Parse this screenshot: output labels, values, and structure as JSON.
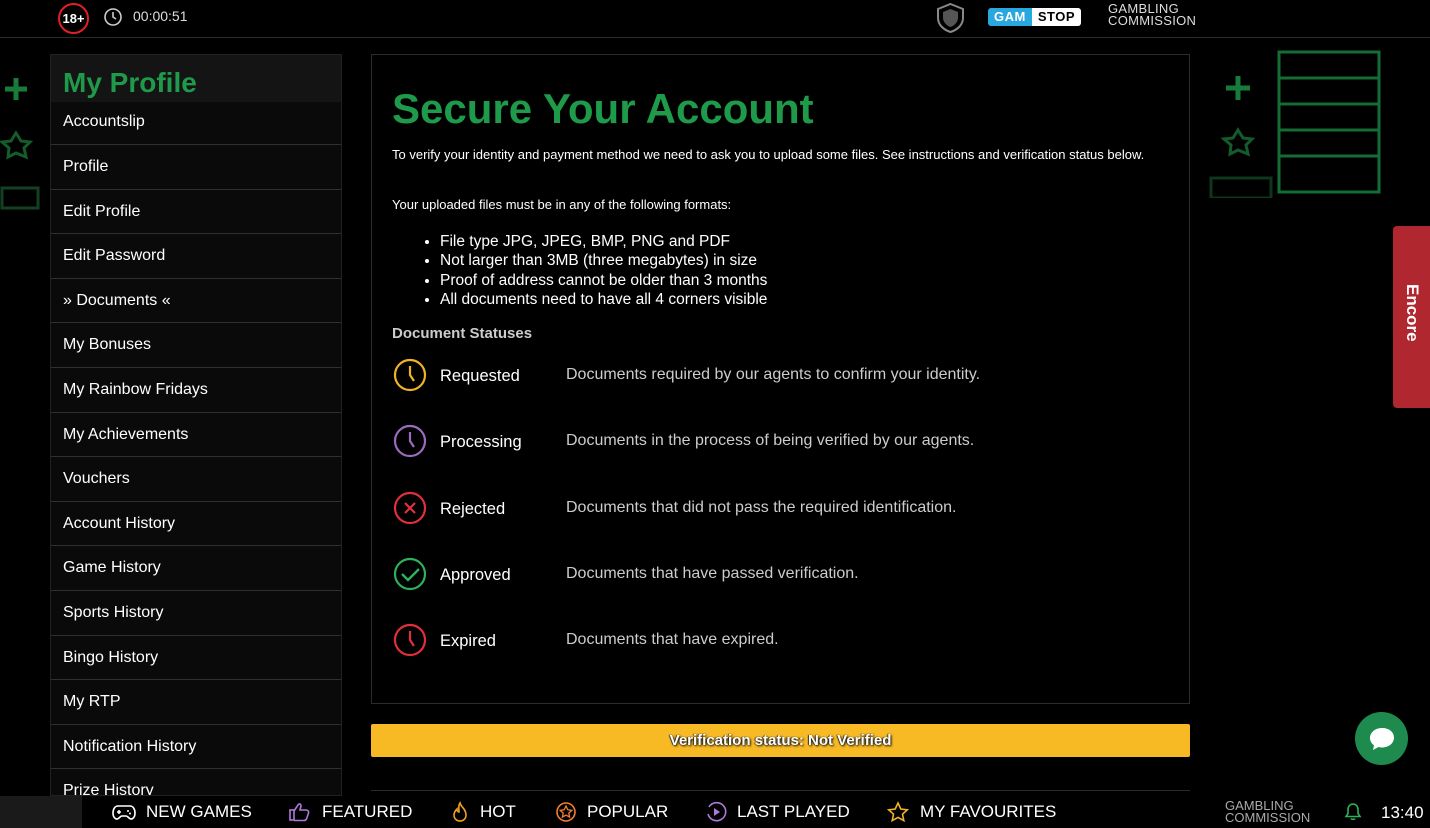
{
  "topbar": {
    "age_label": "18+",
    "timer": "00:00:51",
    "gamstop_gam": "GAM",
    "gamstop_stop": "STOP",
    "gc_line1": "GAMBLING",
    "gc_line2": "COMMISSION"
  },
  "sidebar": {
    "title": "My Profile",
    "items": [
      {
        "label": "Accountslip"
      },
      {
        "label": "Profile"
      },
      {
        "label": "Edit Profile"
      },
      {
        "label": "Edit Password"
      },
      {
        "label": "» Documents «"
      },
      {
        "label": "My Bonuses"
      },
      {
        "label": "My Rainbow Fridays"
      },
      {
        "label": "My Achievements"
      },
      {
        "label": "Vouchers"
      },
      {
        "label": "Account History"
      },
      {
        "label": "Game History"
      },
      {
        "label": "Sports History"
      },
      {
        "label": "Bingo History"
      },
      {
        "label": "My RTP"
      },
      {
        "label": "Notification History"
      },
      {
        "label": "Prize History"
      }
    ]
  },
  "main": {
    "title": "Secure Your Account",
    "intro": "To verify your identity and payment method we need to ask you to upload some files. See instructions and verification status below.",
    "formats_intro": "Your uploaded files must be in any of the following formats:",
    "formats": [
      "File type JPG, JPEG, BMP, PNG and PDF",
      "Not larger than 3MB (three megabytes) in size",
      "Proof of address cannot be older than 3 months",
      "All documents need to have all 4 corners visible"
    ],
    "statuses_title": "Document Statuses",
    "statuses": [
      {
        "name": "Requested",
        "desc": "Documents required by our agents to confirm your identity.",
        "color": "#f0b323",
        "icon": "clock-icon"
      },
      {
        "name": "Processing",
        "desc": "Documents in the process of being verified by our agents.",
        "color": "#9b6bbf",
        "icon": "clock-icon"
      },
      {
        "name": "Rejected",
        "desc": "Documents that did not pass the required identification.",
        "color": "#e0303a",
        "icon": "x-icon"
      },
      {
        "name": "Approved",
        "desc": "Documents that have passed verification.",
        "color": "#2fb05a",
        "icon": "check-icon"
      },
      {
        "name": "Expired",
        "desc": "Documents that have expired.",
        "color": "#e0303a",
        "icon": "clock-icon"
      }
    ]
  },
  "verification": {
    "text": "Verification status:  Not Verified",
    "color": "#f7b924"
  },
  "encore": {
    "label": "Encore"
  },
  "bottombar": {
    "items": [
      {
        "label": "NEW GAMES",
        "icon": "gamepad-icon"
      },
      {
        "label": "FEATURED",
        "icon": "thumbs-up-icon"
      },
      {
        "label": "HOT",
        "icon": "flame-icon"
      },
      {
        "label": "POPULAR",
        "icon": "star-badge-icon"
      },
      {
        "label": "LAST PLAYED",
        "icon": "play-history-icon"
      },
      {
        "label": "MY FAVOURITES",
        "icon": "star-icon"
      }
    ],
    "gc_line1": "GAMBLING",
    "gc_line2": "COMMISSION",
    "time": "13:40"
  },
  "colors": {
    "accent_green": "#1f9a4a",
    "encore_red": "#b0272f",
    "chat_green": "#1f8a4e"
  }
}
